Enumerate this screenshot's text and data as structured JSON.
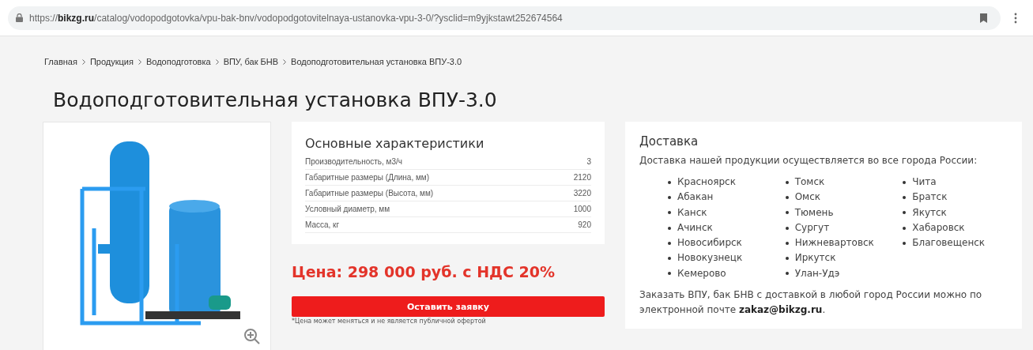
{
  "address_bar": {
    "url_prefix": "https://",
    "url_domain": "bikzg.ru",
    "url_path": "/catalog/vodopodgotovka/vpu-bak-bnv/vodopodgotovitelnaya-ustanovka-vpu-3-0/?ysclid=m9yjkstawt252674564"
  },
  "breadcrumbs": [
    "Главная",
    "Продукция",
    "Водоподготовка",
    "ВПУ, бак БНВ",
    "Водоподготовительная установка ВПУ-3.0"
  ],
  "title": "Водоподготовительная установка ВПУ-3.0",
  "specs": {
    "title": "Основные характеристики",
    "rows": [
      {
        "label": "Производительность, м3/ч",
        "value": "3"
      },
      {
        "label": "Габаритные размеры (Длина, мм)",
        "value": "2120"
      },
      {
        "label": "Габаритные размеры (Высота, мм)",
        "value": "3220"
      },
      {
        "label": "Условный диаметр, мм",
        "value": "1000"
      },
      {
        "label": "Масса, кг",
        "value": "920"
      }
    ]
  },
  "price": "Цена: 298 000 руб. с НДС 20%",
  "order_button": "Оставить заявку",
  "footnote": "*Цена может меняться и не является публичной офертой",
  "delivery": {
    "title": "Доставка",
    "intro": "Доставка нашей продукции осуществляется во все города России:",
    "city_columns": [
      [
        "Красноярск",
        "Абакан",
        "Канск",
        "Ачинск",
        "Новосибирск",
        "Новокузнецк",
        "Кемерово"
      ],
      [
        "Томск",
        "Омск",
        "Тюмень",
        "Сургут",
        "Нижневартовск",
        "Иркутск",
        "Улан-Удэ"
      ],
      [
        "Чита",
        "Братск",
        "Якутск",
        "Хабаровск",
        "Благовещенск"
      ]
    ],
    "order_text": "Заказать ВПУ, бак БНВ с доставкой в любой город России можно по электронной почте ",
    "email": "zakaz@bikzg.ru",
    "order_text_end": "."
  }
}
